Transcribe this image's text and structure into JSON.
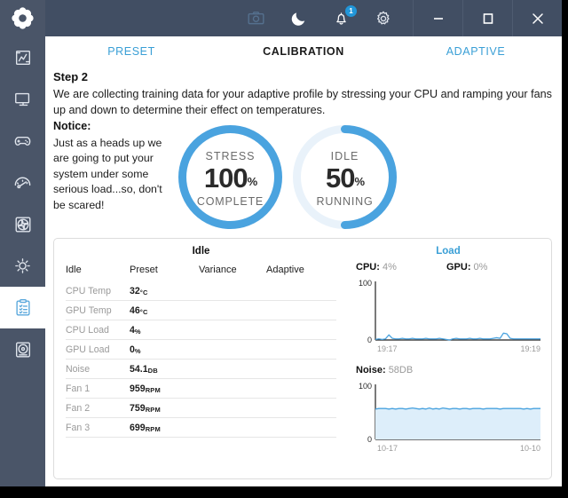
{
  "window": {
    "logo_icon": "hexaflower-logo",
    "titlebar_icons": [
      {
        "name": "camera-icon",
        "label": "screenshot"
      },
      {
        "name": "moon-icon",
        "label": "night-mode"
      },
      {
        "name": "bell-icon",
        "label": "notifications",
        "badge": "1"
      },
      {
        "name": "gear-icon",
        "label": "settings"
      }
    ],
    "controls": [
      {
        "name": "minimize-button",
        "glyph": "minimize"
      },
      {
        "name": "maximize-button",
        "glyph": "maximize"
      },
      {
        "name": "close-button",
        "glyph": "close"
      }
    ]
  },
  "sidebar": {
    "items": [
      {
        "name": "sidebar-item-dashboard",
        "icon": "report-chart-icon",
        "active": false
      },
      {
        "name": "sidebar-item-monitor",
        "icon": "monitor-icon",
        "active": false
      },
      {
        "name": "sidebar-item-games",
        "icon": "gamepad-icon",
        "active": false
      },
      {
        "name": "sidebar-item-performance",
        "icon": "gauge-icon",
        "active": false
      },
      {
        "name": "sidebar-item-fans",
        "icon": "fan-icon",
        "active": false
      },
      {
        "name": "sidebar-item-lighting",
        "icon": "sun-icon",
        "active": false
      },
      {
        "name": "sidebar-item-calibration",
        "icon": "clipboard-checklist-icon",
        "active": true
      },
      {
        "name": "sidebar-item-storage",
        "icon": "disc-drive-icon",
        "active": false
      }
    ]
  },
  "tabs": [
    {
      "label": "PRESET",
      "active": false
    },
    {
      "label": "CALIBRATION",
      "active": true
    },
    {
      "label": "ADAPTIVE",
      "active": false
    }
  ],
  "step": {
    "title": "Step 2",
    "description": "We are collecting training data for your adaptive profile by stressing your CPU and ramping your fans up and down to determine their effect on temperatures."
  },
  "notice": {
    "title": "Notice:",
    "body": "Just as a heads up we are going to put your system under some serious load...so, don't be scared!"
  },
  "gauges": [
    {
      "name": "stress-gauge",
      "top_label": "STRESS",
      "value": "100",
      "unit": "%",
      "bottom_label": "COMPLETE",
      "percent": 100
    },
    {
      "name": "idle-gauge",
      "top_label": "IDLE",
      "value": "50",
      "unit": "%",
      "bottom_label": "RUNNING",
      "percent": 50
    }
  ],
  "table": {
    "title": "Idle",
    "headers": [
      "Idle",
      "Preset",
      "Variance",
      "Adaptive"
    ],
    "rows": [
      {
        "label": "CPU Temp",
        "preset": "32",
        "unit": "°C",
        "variance": "",
        "adaptive": ""
      },
      {
        "label": "GPU Temp",
        "preset": "46",
        "unit": "°C",
        "variance": "",
        "adaptive": ""
      },
      {
        "label": "CPU Load",
        "preset": "4",
        "unit": "%",
        "variance": "",
        "adaptive": ""
      },
      {
        "label": "GPU Load",
        "preset": "0",
        "unit": "%",
        "variance": "",
        "adaptive": ""
      },
      {
        "label": "Noise",
        "preset": "54.1",
        "unit": "DB",
        "variance": "",
        "adaptive": ""
      },
      {
        "label": "Fan 1",
        "preset": "959",
        "unit": "RPM",
        "variance": "",
        "adaptive": ""
      },
      {
        "label": "Fan 2",
        "preset": "759",
        "unit": "RPM",
        "variance": "",
        "adaptive": ""
      },
      {
        "label": "Fan 3",
        "preset": "699",
        "unit": "RPM",
        "variance": "",
        "adaptive": ""
      }
    ]
  },
  "charts_title": "Load",
  "chart_data": [
    {
      "type": "line",
      "name": "load-chart",
      "title": "Load",
      "stats": [
        {
          "label": "CPU:",
          "value": "4%"
        },
        {
          "label": "GPU:",
          "value": "0%"
        }
      ],
      "ylabel": "",
      "ylim": [
        0,
        100
      ],
      "yticks": [
        "0",
        "100"
      ],
      "xlabel": "",
      "xticks": [
        "19:17",
        "19:19"
      ],
      "grid": false,
      "legend": "none",
      "series": [
        {
          "name": "CPU",
          "color": "#4aa3df",
          "values": [
            1,
            2,
            1,
            2,
            9,
            3,
            2,
            2,
            3,
            2,
            2,
            3,
            2,
            2,
            2,
            3,
            2,
            2,
            2,
            3,
            2,
            1,
            0,
            2,
            3,
            2,
            2,
            2,
            3,
            2,
            2,
            3,
            2,
            2,
            2,
            3,
            4,
            3,
            12,
            11,
            3,
            2,
            2,
            2,
            2,
            2,
            2,
            2,
            2,
            2
          ]
        }
      ]
    },
    {
      "type": "area",
      "name": "noise-chart",
      "title": "",
      "stats": [
        {
          "label": "Noise:",
          "value": "58DB"
        }
      ],
      "ylabel": "",
      "ylim": [
        0,
        100
      ],
      "yticks": [
        "0",
        "100"
      ],
      "xlabel": "",
      "xticks": [
        "10-17",
        "10-10"
      ],
      "grid": false,
      "legend": "none",
      "series": [
        {
          "name": "Noise",
          "color": "#4aa3df",
          "fill": "#ddeefa",
          "values": [
            57,
            58,
            58,
            58,
            57,
            58,
            57,
            58,
            58,
            57,
            58,
            59,
            58,
            57,
            58,
            57,
            59,
            57,
            58,
            57,
            59,
            58,
            57,
            58,
            58,
            57,
            58,
            58,
            57,
            58,
            58,
            58,
            57,
            58,
            58,
            58,
            58,
            57,
            58,
            58,
            58,
            58,
            58,
            58,
            57,
            58,
            57,
            58,
            58,
            58
          ]
        }
      ]
    }
  ],
  "colors": {
    "accent": "#3a9fd6",
    "ring": "#4aa3df",
    "ring_track": "#e9f2fa",
    "chrome": "#4a5568",
    "titlebar": "#414e63"
  }
}
